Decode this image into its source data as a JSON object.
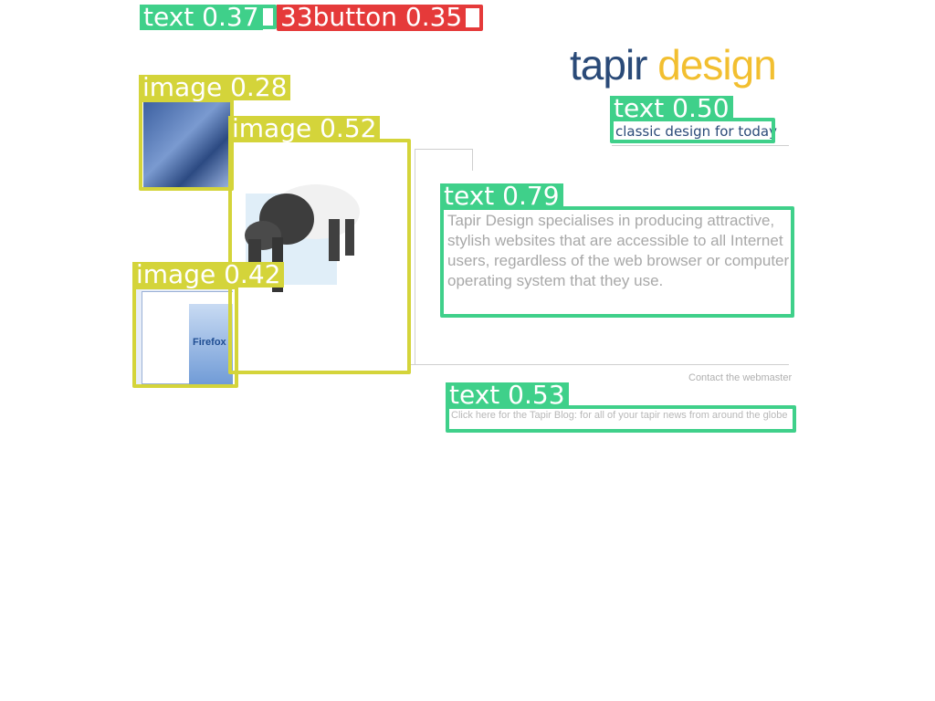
{
  "brand": {
    "word1": "tapir",
    "word2": "design",
    "tagline": "classic design for today"
  },
  "intro": "Tapir Design specialises in producing attractive, stylish websites that are accessible to all Internet users, regardless of the web browser or computer operating system that they use.",
  "contact_link": "Contact the webmaster",
  "blog_link": "Click here for the Tapir Blog: for all of your tapir news from around the globe",
  "screenshot_thumb_text": "Firefox",
  "detections": [
    {
      "label": "text 0.37"
    },
    {
      "label": "33button 0.35"
    },
    {
      "label": "image 0.28"
    },
    {
      "label": "image 0.52"
    },
    {
      "label": "text 0.50"
    },
    {
      "label": "text 0.79"
    },
    {
      "label": "image 0.42"
    },
    {
      "label": "text 0.53"
    }
  ],
  "colors": {
    "brand_blue": "#2a4a78",
    "brand_yellow": "#f2bf30",
    "det_green": "#3fd08a",
    "det_yellow": "#d4d43a",
    "det_red": "#e53a3a"
  }
}
